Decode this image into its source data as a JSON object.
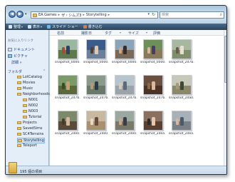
{
  "window": {
    "nav_back_glyph": "◀",
    "nav_forward_glyph": "▶",
    "nav_drop_glyph": "▾",
    "breadcrumb": [
      "EA Games",
      "ザ・シムズ3",
      "Storytelling"
    ],
    "breadcrumb_separator": "▸",
    "address_drop_glyph": "▾",
    "refresh_glyph": "↻",
    "search_placeholder": "検索",
    "search_glyph": "⌕"
  },
  "toolbar": {
    "items": [
      {
        "label": "整理",
        "icon": "organize-icon",
        "icon_color": "#d9e6f2"
      },
      {
        "label": "表示",
        "icon": "views-icon",
        "icon_color": "#cfe0f0"
      },
      {
        "label": "スライド ショー",
        "icon": "slideshow-icon",
        "icon_color": "#6fb6e8"
      },
      {
        "label": "書き込む",
        "icon": "burn-icon",
        "icon_color": "#e07a3a"
      }
    ],
    "drop_glyph": "▾"
  },
  "navpane": {
    "favorites_title": "お気に入りリンク",
    "favorites": [
      {
        "label": "ドキュメント",
        "icon": "documents-icon"
      },
      {
        "label": "ピクチャ",
        "icon": "pictures-icon"
      }
    ],
    "more_label": "詳細 »",
    "folders_label": "フォルダ",
    "folders_chevron": "⌃",
    "tree": [
      {
        "label": "LotCatalog",
        "selected": false
      },
      {
        "label": "Movies",
        "selected": false
      },
      {
        "label": "Music",
        "selected": false
      },
      {
        "label": "Neighborhoods",
        "selected": false
      },
      {
        "label": "N001",
        "selected": false
      },
      {
        "label": "N002",
        "selected": false
      },
      {
        "label": "N003",
        "selected": false
      },
      {
        "label": "Tutorial",
        "selected": false
      },
      {
        "label": "Projects",
        "selected": false
      },
      {
        "label": "SavedSims",
        "selected": false
      },
      {
        "label": "SC4Terrains",
        "selected": false
      },
      {
        "label": "Storytelling",
        "selected": true
      },
      {
        "label": "Teleport",
        "selected": false
      }
    ]
  },
  "columns": {
    "headers": [
      "名前",
      "撮影日",
      "タグ",
      "サイズ",
      "評価"
    ],
    "drop_glyph": "▾"
  },
  "files": {
    "items": [
      {
        "label": "snapshot_0000...",
        "sky": "#9ab7a0",
        "ground": "#5f7a4a",
        "fig": "#2f3f6a",
        "fig2": "#a84a3a"
      },
      {
        "label": "snapshot_0000...",
        "sky": "#3a5c8a",
        "ground": "#6a7f9a",
        "fig": "#e0c8a8",
        "fig2": "#5a3a2a"
      },
      {
        "label": "snapshot_0000...",
        "sky": "#8aa4b8",
        "ground": "#7a6a5a",
        "fig": "#3a2a2a",
        "fig2": "#c8a888"
      },
      {
        "label": "snapshot_0000...",
        "sky": "#6f8f5a",
        "ground": "#8a7a5a",
        "fig": "#4a3a6a",
        "fig2": "#d8b898"
      },
      {
        "label": "snapshot_2d7b...",
        "sky": "#a8b8a0",
        "ground": "#7f8f6a",
        "fig": "#e8e0d0",
        "fig2": "#6a5a4a"
      },
      {
        "label": "snapshot_2d7b...",
        "sky": "#7a9a6a",
        "ground": "#5a6a3a",
        "fig": "#c8a070",
        "fig2": "#3a4a2a"
      },
      {
        "label": "snapshot_2d7b...",
        "sky": "#8a9a8a",
        "ground": "#6a7a6a",
        "fig": "#2a3a4a",
        "fig2": "#b89878"
      },
      {
        "label": "snapshot_2d7b...",
        "sky": "#b8c4cc",
        "ground": "#9aa4aa",
        "fig": "#5a6a7a",
        "fig2": "#d8c8b8"
      },
      {
        "label": "snapshot_2d7b...",
        "sky": "#6a5040",
        "ground": "#4a3428",
        "fig": "#e0b898",
        "fig2": "#8a6a4a"
      },
      {
        "label": "snapshot_2da0...",
        "sky": "#c8c8b8",
        "ground": "#8a8a6a",
        "fig": "#3a4a3a",
        "fig2": "#a89878"
      },
      {
        "label": "snapshot_2de0...",
        "sky": "#7a8a6a",
        "ground": "#5a4a3a",
        "fig": "#d8b898",
        "fig2": "#4a3a2a"
      },
      {
        "label": "snapshot_2de0...",
        "sky": "#c8b8a0",
        "ground": "#a89070",
        "fig": "#6a4a3a",
        "fig2": "#e8d8c8"
      },
      {
        "label": "snapshot_2de0...",
        "sky": "#9aa8a0",
        "ground": "#7a7a6a",
        "fig": "#3a3a4a",
        "fig2": "#c8a888"
      },
      {
        "label": "snapshot_2dea...",
        "sky": "#8a7060",
        "ground": "#5a4030",
        "fig": "#e8c8a8",
        "fig2": "#2a2a2a"
      },
      {
        "label": "snapshot_2dea...",
        "sky": "#a8b0b8",
        "ground": "#7a8088",
        "fig": "#4a5a6a",
        "fig2": "#d8b898"
      }
    ]
  },
  "details": {
    "count_label": "195 個の項目"
  }
}
